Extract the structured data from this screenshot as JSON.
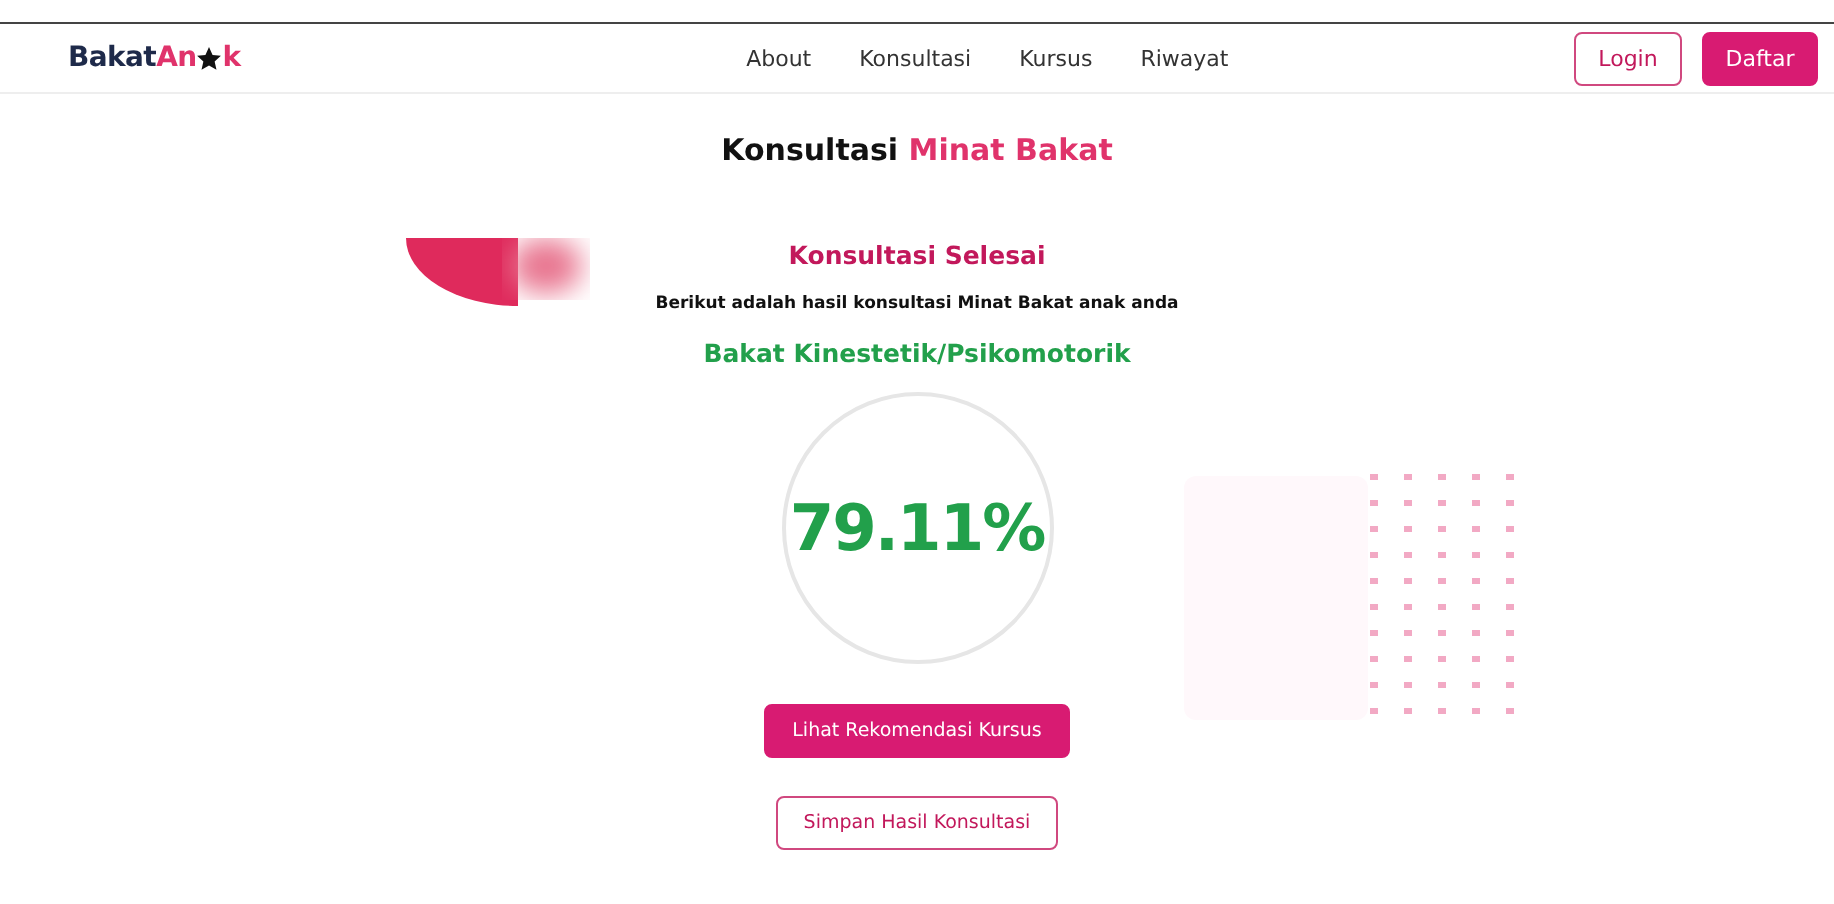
{
  "navbar": {
    "logo": {
      "dark": "Bakat",
      "accent_start": "An",
      "accent_end": "k"
    },
    "links": [
      {
        "label": "About"
      },
      {
        "label": "Konsultasi"
      },
      {
        "label": "Kursus"
      },
      {
        "label": "Riwayat"
      }
    ],
    "buttons": [
      {
        "label": "Login",
        "kind": "outline"
      },
      {
        "label": "Daftar",
        "kind": "filled"
      }
    ]
  },
  "page_title": {
    "plain": "Konsultasi",
    "accent": "Minat Bakat"
  },
  "result": {
    "heading": "Konsultasi Selesai",
    "description": "Berikut adalah hasil konsultasi Minat Bakat anak anda",
    "talent": "Bakat Kinestetik/Psikomotorik",
    "score": "79.11%"
  },
  "actions": [
    {
      "label": "Lihat Rekomendasi Kursus",
      "kind": "filled"
    },
    {
      "label": "Simpan Hasil Konsultasi",
      "kind": "outline"
    }
  ]
}
